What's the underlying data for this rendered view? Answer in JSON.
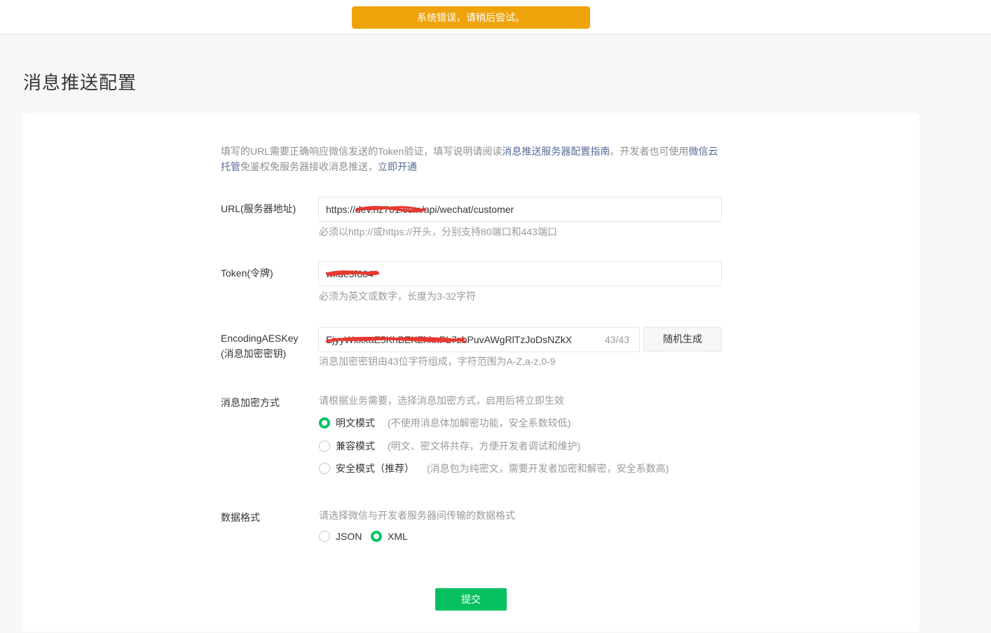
{
  "toast": {
    "message": "系统错误，请稍后尝试。"
  },
  "page_title": "消息推送配置",
  "intro": {
    "text1": "填写的URL需要正确响应微信发送的Token验证，填写说明请阅读",
    "link_guide": "消息推送服务器配置指南",
    "text2": "。开发者也可使用",
    "link_cloud": "微信云托管",
    "text3": "免鉴权免服务器接收消息推送，",
    "link_open": "立即开通"
  },
  "url_field": {
    "label": "URL(服务器地址)",
    "value": "https://dev.hz761.com/api/wechat/customer",
    "hint": "必须以http://或https://开头，分别支持80端口和443端口"
  },
  "token_field": {
    "label": "Token(令牌)",
    "value": "wxde5f684",
    "hint": "必须为英文或数字，长度为3-32字符"
  },
  "aes_field": {
    "label_line1": "EncodingAESKey",
    "label_line2": "(消息加密密钥)",
    "value": "EjyyWxxxaE5KhBEKZhknPL7zbPuvAWgRlTzJoDsNZkX",
    "counter": "43/43",
    "generate_label": "随机生成",
    "hint": "消息加密密钥由43位字符组成，字符范围为A-Z,a-z,0-9"
  },
  "encrypt_mode": {
    "label": "消息加密方式",
    "hint": "请根据业务需要，选择消息加密方式，启用后将立即生效",
    "options": [
      {
        "label": "明文模式",
        "desc": "(不使用消息体加解密功能，安全系数较低)",
        "checked": true
      },
      {
        "label": "兼容模式",
        "desc": "(明文、密文将共存，方便开发者调试和维护)",
        "checked": false
      },
      {
        "label": "安全模式（推荐）",
        "desc": "(消息包为纯密文，需要开发者加密和解密，安全系数高)",
        "checked": false
      }
    ]
  },
  "data_format": {
    "label": "数据格式",
    "hint": "请选择微信与开发者服务器间传输的数据格式",
    "options": [
      {
        "label": "JSON",
        "checked": false
      },
      {
        "label": "XML",
        "checked": true
      }
    ]
  },
  "submit_label": "提交",
  "colors": {
    "accent": "#07c160",
    "toast": "#eea30b",
    "link": "#576b95",
    "redaction": "#e8382f"
  }
}
